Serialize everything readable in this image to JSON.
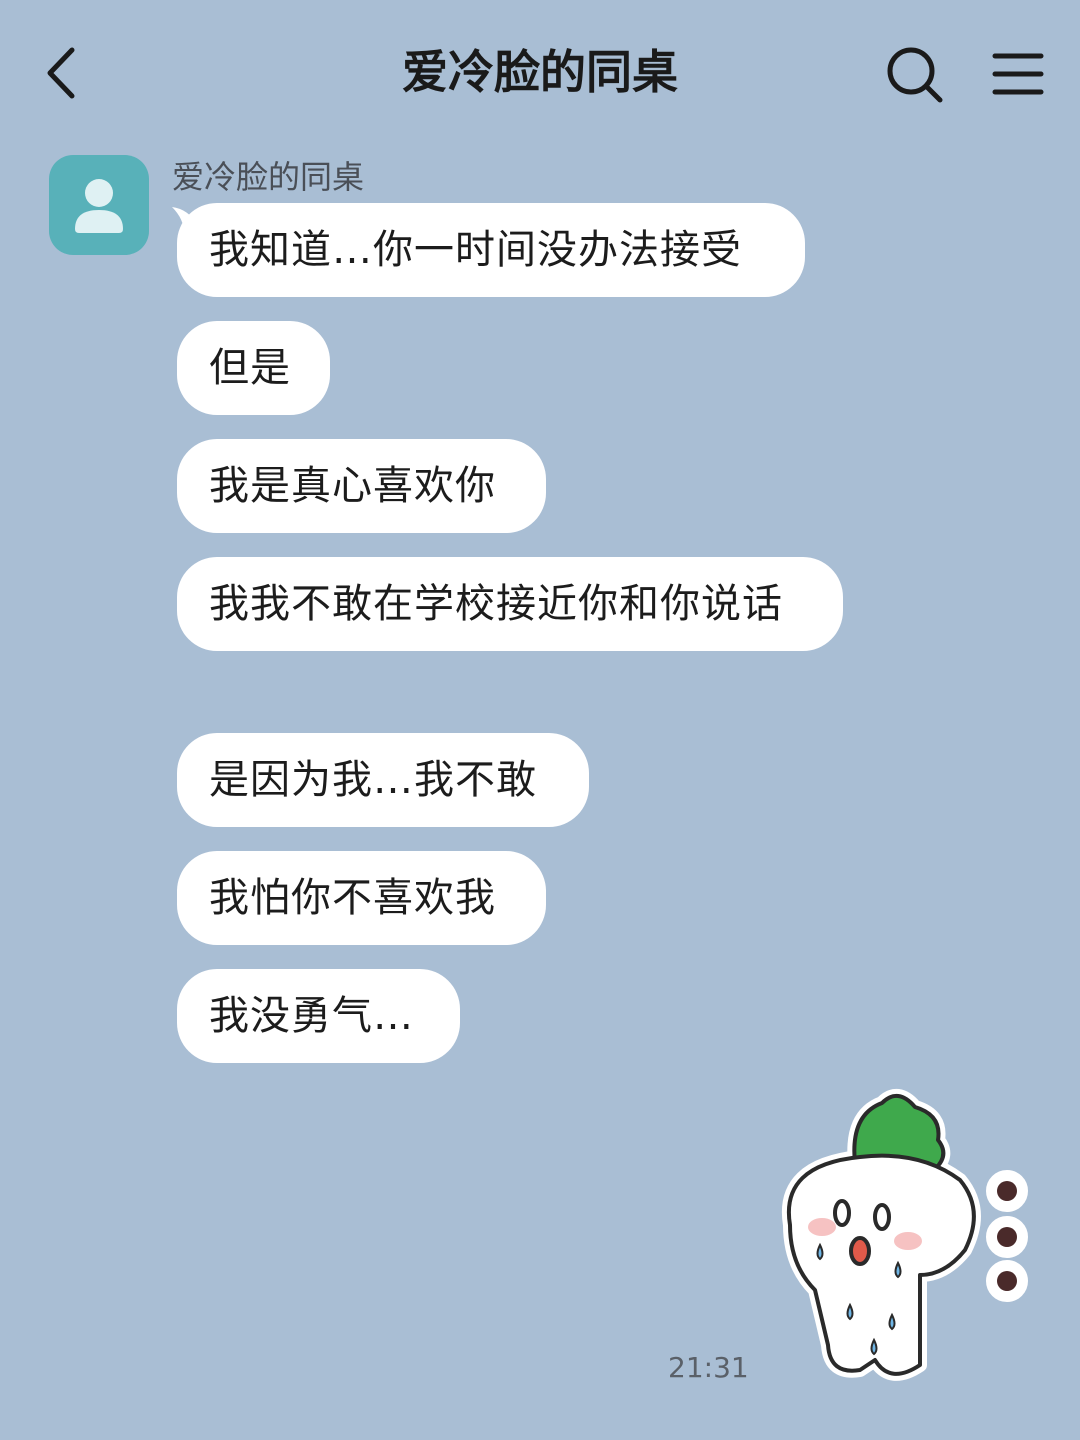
{
  "header": {
    "title": "爱冷脸的同桌",
    "back_icon": "chevron-left-icon",
    "search_icon": "search-icon",
    "menu_icon": "menu-icon"
  },
  "contact": {
    "name": "爱冷脸的同桌",
    "avatar_icon": "person-icon",
    "avatar_color": "#58b1b9"
  },
  "messages": [
    {
      "text": "我知道…你一时间没办法接受"
    },
    {
      "text": "但是"
    },
    {
      "text": "我是真心喜欢你"
    },
    {
      "text": "我我不敢在学校接近你和你说话"
    },
    {
      "text": "是因为我…我不敢"
    },
    {
      "text": "我怕你不喜欢我"
    },
    {
      "text": "我没勇气…"
    }
  ],
  "timestamp": "21:31",
  "sticker": {
    "icon": "crying-radish-sticker"
  },
  "colors": {
    "background": "#a9bed4",
    "bubble": "#ffffff",
    "accent": "#58b1b9"
  }
}
